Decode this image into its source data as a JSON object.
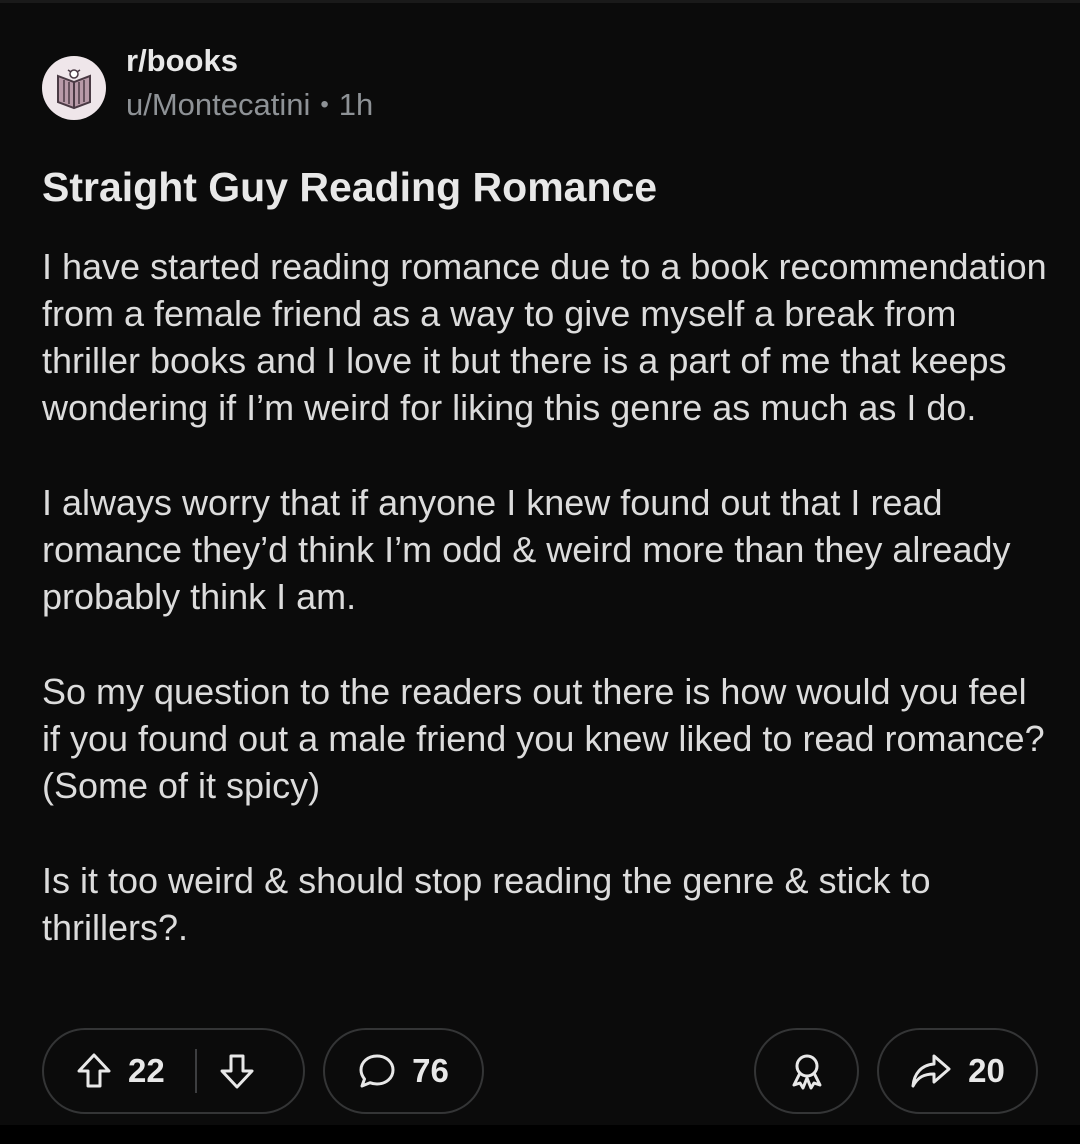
{
  "post": {
    "subreddit": "r/books",
    "author": "u/Montecatini",
    "separator": "•",
    "age": "1h",
    "title": "Straight Guy Reading Romance",
    "paragraphs": [
      "I have started reading romance due to a book recommendation from a female friend as a way to give myself a break from thriller books and I love it but there is a part of me that keeps wondering if I’m weird for liking this genre as much as I do.",
      "I always worry that if anyone I knew found out that I read romance they’d think I’m odd & weird more than they already probably think I am.",
      "So my question to the readers out there is how would you feel if you found out a male friend you knew liked to read romance? (Some of it spicy)",
      "Is it too weird & should stop reading the genre & stick to thrillers?."
    ]
  },
  "actions": {
    "upvotes": "22",
    "comments": "76",
    "shares": "20"
  },
  "icons": {
    "avatar": "book-icon",
    "upvote": "arrow-up-icon",
    "downvote": "arrow-down-icon",
    "comment": "speech-bubble-icon",
    "award": "award-ribbon-icon",
    "share": "share-arrow-icon"
  },
  "colors": {
    "background": "#0b0b0b",
    "text": "#dcdcdc",
    "muted": "#8e9296",
    "pill_border": "#343536"
  }
}
